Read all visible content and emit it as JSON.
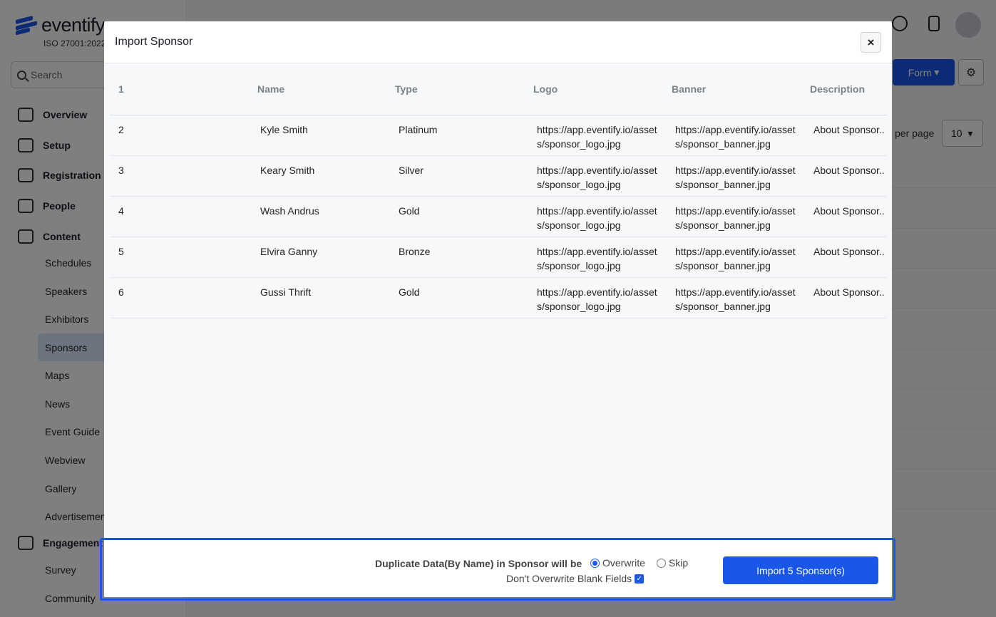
{
  "app": {
    "brand": "eventify",
    "iso": "ISO 27001:2022",
    "search_placeholder": "Search",
    "nav": [
      {
        "label": "Overview",
        "icon": "home-icon"
      },
      {
        "label": "Setup",
        "icon": "layers-icon"
      },
      {
        "label": "Registration",
        "icon": "ticket-icon"
      },
      {
        "label": "People",
        "icon": "people-icon"
      },
      {
        "label": "Content",
        "icon": "content-icon"
      }
    ],
    "content_items": [
      "Schedules",
      "Speakers",
      "Exhibitors",
      "Sponsors",
      "Maps",
      "News",
      "Event Guide",
      "Webview",
      "Gallery",
      "Advertisement"
    ],
    "engagement": {
      "label": "Engagement",
      "icon": "bolt-icon"
    },
    "engagement_items": [
      "Survey",
      "Community"
    ],
    "form_button": "Form",
    "per_page_label": "per page",
    "per_page_value": "10"
  },
  "modal": {
    "title": "Import Sponsor",
    "close_label": "×",
    "columns": [
      "1",
      "Name",
      "Type",
      "Logo",
      "Banner",
      "Description"
    ],
    "rows": [
      {
        "num": "2",
        "name": "Kyle Smith",
        "type": "Platinum",
        "logo": "https://app.eventify.io/assets/sponsor_logo.jpg",
        "banner": "https://app.eventify.io/assets/sponsor_banner.jpg",
        "description": "About Sponsor.."
      },
      {
        "num": "3",
        "name": "Keary Smith",
        "type": "Silver",
        "logo": "https://app.eventify.io/assets/sponsor_logo.jpg",
        "banner": "https://app.eventify.io/assets/sponsor_banner.jpg",
        "description": "About Sponsor.."
      },
      {
        "num": "4",
        "name": "Wash Andrus",
        "type": "Gold",
        "logo": "https://app.eventify.io/assets/sponsor_logo.jpg",
        "banner": "https://app.eventify.io/assets/sponsor_banner.jpg",
        "description": "About Sponsor.."
      },
      {
        "num": "5",
        "name": "Elvira Ganny",
        "type": "Bronze",
        "logo": "https://app.eventify.io/assets/sponsor_logo.jpg",
        "banner": "https://app.eventify.io/assets/sponsor_banner.jpg",
        "description": "About Sponsor.."
      },
      {
        "num": "6",
        "name": "Gussi Thrift",
        "type": "Gold",
        "logo": "https://app.eventify.io/assets/sponsor_logo.jpg",
        "banner": "https://app.eventify.io/assets/sponsor_banner.jpg",
        "description": "About Sponsor.."
      }
    ],
    "duplicate_label": "Duplicate Data(By Name) in Sponsor will be",
    "option_overwrite": "Overwrite",
    "option_skip": "Skip",
    "selected_option": "Overwrite",
    "blank_fields_label": "Don't Overwrite Blank Fields",
    "blank_fields_checked": true,
    "import_button": "Import 5 Sponsor(s)"
  },
  "colors": {
    "accent": "#1a57e8",
    "overlay": "rgba(0,0,0,0.5)"
  }
}
